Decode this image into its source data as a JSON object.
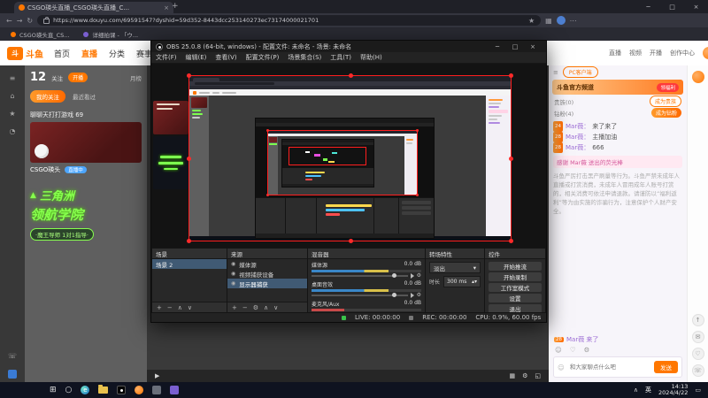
{
  "browser": {
    "tab": {
      "title": "CSGO瑛头直播_CSGO瑛头直播_C..."
    },
    "url": "https://www.douyu.com/69591547?dyshid=59d352-8443dcc253140273ec73174000021701",
    "bookmarks": [
      {
        "label": "CSGO瑛头直_CS..."
      },
      {
        "label": "详细拍课 - 「ウ..."
      }
    ]
  },
  "taskbar": {
    "lang": "英",
    "time": "14:13",
    "date": "2024/4/22"
  },
  "douyu": {
    "logo_badge": "斗",
    "logo_text": "斗鱼",
    "nav": [
      "首页",
      "直播",
      "分类",
      "赛事"
    ],
    "right_nav": [
      "直播",
      "视频",
      "开播",
      "创作中心"
    ],
    "left": {
      "follow_count": "12",
      "follow_label": "关注",
      "live_pill": "开播",
      "rank_label": "月榜",
      "my_follow": "我的关注",
      "recent": "最近看过",
      "card_title": "聊聊天打打游戏 69",
      "streamer": "CSGO瑛头",
      "live_badge": "直播中",
      "promo_line1": "三角洲",
      "promo_line2": "领航学院",
      "promo_line3": "·魔王导师 1对1指导·"
    },
    "chat": {
      "client_button": "PC客户端",
      "banner_title": "斗鱼官方频道",
      "banner_action": "领福利",
      "noble_label": "贵族(0)",
      "noble_button": "成为贵族",
      "fan_label": "钻粉(4)",
      "fan_button": "成为钻粉",
      "messages": [
        {
          "badge": "24",
          "name": "Mar薇",
          "text": "来了来了"
        },
        {
          "badge": "28",
          "name": "Mar薇",
          "text": "主播加油"
        },
        {
          "badge": "28",
          "name": "Mar薇",
          "text": "666"
        }
      ],
      "gift_notice": "感谢 Mar薇 送出的荧光棒",
      "notice": "斗鱼严厉打击黑产刷量等行为。斗鱼严禁未成年人直播或打赏消费，未成年人冒用成年人账号打赏的，相关消费可依法申请退款。请谨防以“福利返利”等为由实施的诈骗行为，注意保护个人财产安全。",
      "entry_badge": "28",
      "entry_text": "Mar薇 来了",
      "input_placeholder": "和大家聊点什么吧",
      "send": "发送"
    }
  },
  "obs": {
    "title": "OBS 25.0.8 (64-bit, windows) - 配置文件: 未命名 - 场景: 未命名",
    "menu": [
      "文件(F)",
      "编辑(E)",
      "查看(V)",
      "配置文件(P)",
      "场景集合(S)",
      "工具(T)",
      "帮助(H)"
    ],
    "scenes": {
      "title": "场景",
      "item": "场景 2"
    },
    "sources": {
      "title": "来源",
      "items": [
        "媒体源",
        "视频捕获设备",
        "显示器捕获"
      ]
    },
    "mixer": {
      "title": "混音器",
      "tracks": [
        {
          "name": "媒体源",
          "db": "0.0 dB"
        },
        {
          "name": "桌面音效",
          "db": "0.0 dB"
        },
        {
          "name": "麦克风/Aux",
          "db": "0.0 dB"
        }
      ]
    },
    "transitions": {
      "title": "转场特性",
      "selected": "淡出",
      "duration_label": "时长",
      "duration": "300 ms"
    },
    "controls": {
      "title": "控件",
      "buttons": [
        "开始推流",
        "开始录制",
        "工作室模式",
        "设置",
        "退出"
      ]
    },
    "status": {
      "live": "LIVE: 00:00:00",
      "rec": "REC: 00:00:00",
      "cpu": "CPU: 0.9%, 60.00 fps"
    }
  },
  "icons": {
    "back": "←",
    "forward": "→",
    "refresh": "↻",
    "star": "★",
    "more": "⋯",
    "plus": "+",
    "close": "×",
    "minimize": "─",
    "maximize": "□",
    "add": "+",
    "remove": "−",
    "gear": "⚙",
    "up": "∧",
    "down": "∨",
    "eye": "◉",
    "dropdown": "▾",
    "play": "▶",
    "menu": "≡",
    "home": "⌂",
    "clock": "◔",
    "smile": "☺",
    "grid": "▦",
    "fullscreen": "◱",
    "start": "⊞",
    "search": "○",
    "heart": "♡",
    "mail": "✉",
    "top": "↑",
    "phone": "☏",
    "stepper": "▴▾",
    "tray": "▭"
  }
}
